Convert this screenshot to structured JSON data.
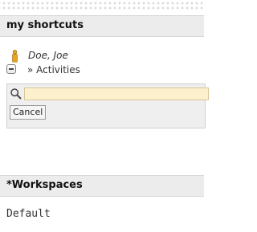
{
  "shortcuts": {
    "header": "my shortcuts",
    "user": {
      "name": "Doe, Joe",
      "icon": "person-icon",
      "icon_color": "#e0a020"
    },
    "activities": {
      "label": "» Activities",
      "icon": "collapse-minus-icon"
    },
    "search": {
      "icon": "magnifier-icon",
      "value": "",
      "field_color": "#fdf0cd",
      "cancel_label": "Cancel"
    }
  },
  "workspaces": {
    "header": "*Workspaces",
    "items": [
      {
        "label": "Default"
      }
    ]
  }
}
